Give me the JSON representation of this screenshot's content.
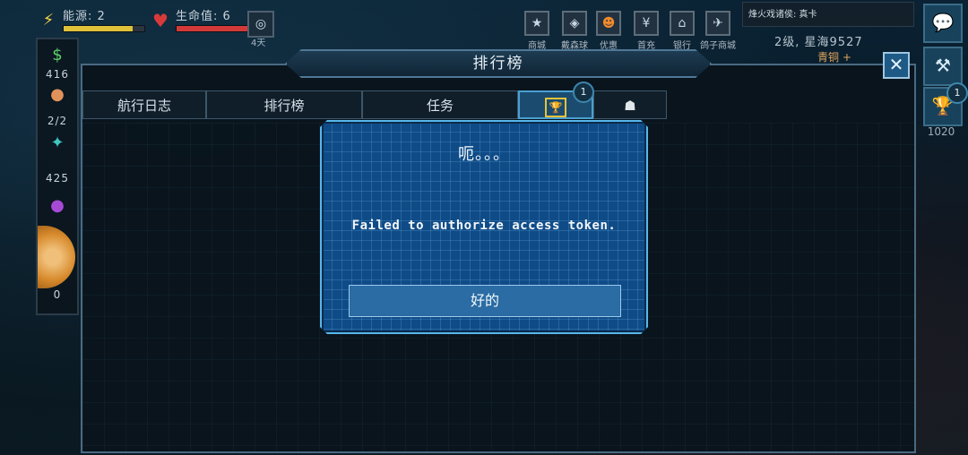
{
  "hud": {
    "energy_label": "能源: 2",
    "health_label": "生命值: 6",
    "day_label": "4天",
    "energy_fill": 0.85,
    "health_fill": 0.95
  },
  "resources": [
    {
      "icon": "money-icon",
      "value": "416"
    },
    {
      "icon": "ore-icon",
      "value": "2/2"
    },
    {
      "icon": "crystal-icon",
      "value": "425"
    },
    {
      "icon": "planet-icon",
      "value": "0"
    }
  ],
  "shop": [
    {
      "icon": "star-icon",
      "label": "商城"
    },
    {
      "icon": "dyson-icon",
      "label": "戴森球"
    },
    {
      "icon": "pumpkin-icon",
      "label": "优惠"
    },
    {
      "icon": "yen-icon",
      "label": "首充"
    },
    {
      "icon": "bank-icon",
      "label": "银行"
    },
    {
      "icon": "pigeon-icon",
      "label": "鸽子商城"
    }
  ],
  "notice": "烽火戏诸侯: 真卡",
  "player": {
    "level_name": "2级, 星海9527",
    "rank": "青铜 +"
  },
  "side": {
    "trophy_badge": "1",
    "trophy_score": "1020"
  },
  "panel": {
    "title": "排行榜",
    "tabs": [
      {
        "label": "航行日志"
      },
      {
        "label": "排行榜"
      },
      {
        "label": "任务"
      }
    ],
    "trophy_tab_badge": "1"
  },
  "dialog": {
    "title": "呃。。。",
    "message": "Failed to authorize access token.",
    "ok_label": "好的"
  },
  "colors": {
    "dialog_bg": "#0f4b87",
    "dialog_border": "#58b7ea",
    "tab_active": "#1b4c70",
    "energy_bar": "#e0c23a",
    "health_bar": "#d23a3a"
  }
}
